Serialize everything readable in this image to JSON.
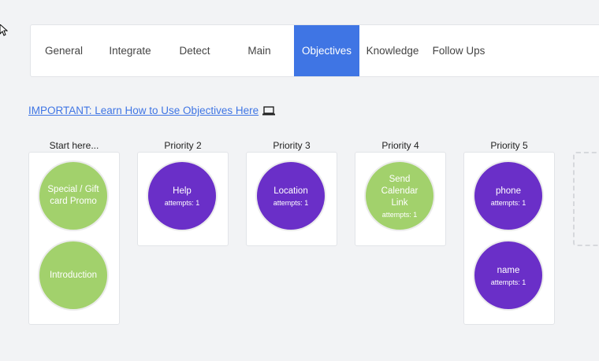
{
  "tabs": [
    {
      "label": "General",
      "active": false
    },
    {
      "label": "Integrate",
      "active": false
    },
    {
      "label": "Detect",
      "active": false
    },
    {
      "label": "Main",
      "active": false
    },
    {
      "label": "Objectives",
      "active": true
    },
    {
      "label": "Knowledge",
      "active": false
    },
    {
      "label": "Follow Ups",
      "active": false
    }
  ],
  "important_link": "IMPORTANT:  Learn How to Use Objectives Here",
  "columns": [
    {
      "label": "Start here...",
      "objectives": [
        {
          "name": "Special / Gift card Promo",
          "attempts": "",
          "color": "#a2d16c"
        },
        {
          "name": "Introduction",
          "attempts": "",
          "color": "#a2d16c"
        }
      ]
    },
    {
      "label": "Priority 2",
      "objectives": [
        {
          "name": "Help",
          "attempts": "attempts: 1",
          "color": "#6a2fc8"
        }
      ]
    },
    {
      "label": "Priority 3",
      "objectives": [
        {
          "name": "Location",
          "attempts": "attempts: 1",
          "color": "#6a2fc8"
        }
      ]
    },
    {
      "label": "Priority 4",
      "objectives": [
        {
          "name": "Send Calendar Link",
          "attempts": "attempts: 1",
          "color": "#a2d16c"
        }
      ]
    },
    {
      "label": "Priority 5",
      "objectives": [
        {
          "name": "phone",
          "attempts": "attempts: 1",
          "color": "#6a2fc8"
        },
        {
          "name": "name",
          "attempts": "attempts: 1",
          "color": "#6a2fc8"
        }
      ]
    }
  ],
  "colors": {
    "accent": "#3f75e4",
    "green": "#a2d16c",
    "purple": "#6a2fc8"
  }
}
